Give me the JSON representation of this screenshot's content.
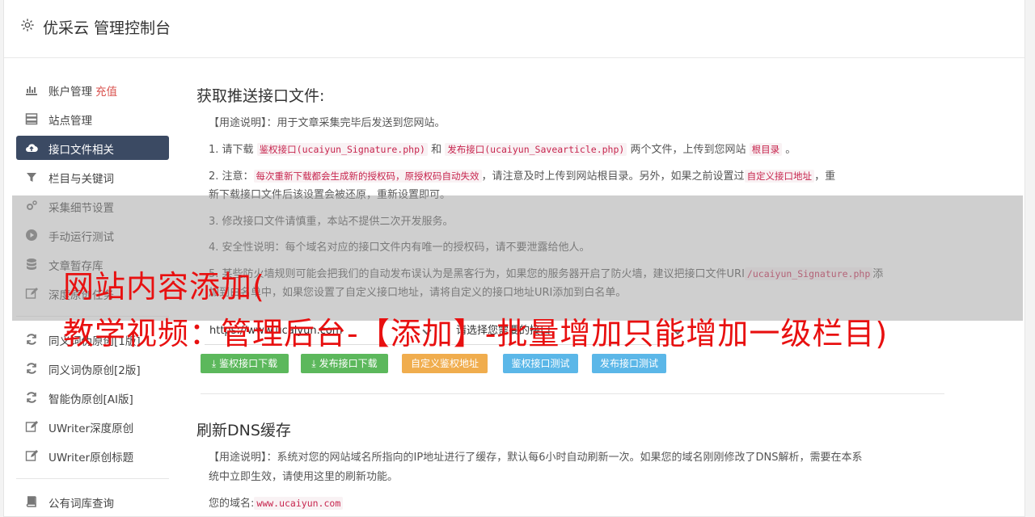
{
  "header": {
    "title": "优采云 管理控制台",
    "icon": "gear-icon"
  },
  "sidebar": {
    "items": [
      {
        "label": "账户管理",
        "extra": "充值",
        "icon": "bar-chart-icon",
        "active": false
      },
      {
        "label": "站点管理",
        "icon": "server-icon",
        "active": false
      },
      {
        "label": "接口文件相关",
        "icon": "cloud-upload-icon",
        "active": true
      },
      {
        "label": "栏目与关键词",
        "icon": "filter-icon",
        "active": false
      },
      {
        "label": "采集细节设置",
        "icon": "cogs-icon",
        "active": false
      },
      {
        "label": "手动运行测试",
        "icon": "play-circle-icon",
        "active": false
      },
      {
        "label": "文章暂存库",
        "icon": "database-icon",
        "active": false
      },
      {
        "label": "深度原创任务",
        "icon": "edit-icon",
        "active": false
      },
      {
        "label": "同义词伪原创[1版]",
        "icon": "refresh-icon",
        "active": false
      },
      {
        "label": "同义词伪原创[2版]",
        "icon": "refresh-icon",
        "active": false
      },
      {
        "label": "智能伪原创[AI版]",
        "icon": "refresh-icon",
        "active": false
      },
      {
        "label": "UWriter深度原创",
        "icon": "edit-icon",
        "active": false
      },
      {
        "label": "UWriter原创标题",
        "icon": "edit-icon",
        "active": false
      },
      {
        "label": "公有词库查询",
        "icon": "book-icon",
        "active": false
      }
    ]
  },
  "section1": {
    "title": "获取推送接口文件:",
    "usage_label": "【用途说明】",
    "usage_text": "：用于文章采集完毕后发送到您网站。",
    "step1": {
      "prefix": "1. 请下载",
      "code1": "鉴权接口(ucaiyun_Signature.php)",
      "mid1": "和",
      "code2": "发布接口(ucaiyun_Savearticle.php)",
      "mid2": "两个文件，上传到您网站",
      "code3": "根目录",
      "suffix": "。"
    },
    "step2": {
      "prefix": "2. 注意：",
      "code1": "每次重新下载都会生成新的授权码，原授权码自动失效",
      "mid1": "，请注意及时上传到网站根目录。另外，如果之前设置过",
      "code2": "自定义接口地址",
      "mid2": "，重",
      "line2": "新下载接口文件后该设置会被还原，重新设置即可。"
    },
    "step3": "3. 修改接口文件请慎重，本站不提供二次开发服务。",
    "step4": "4. 安全性说明：每个域名对应的接口文件内有唯一的授权码，请不要泄露给他人。",
    "step5": {
      "prefix": "5. 某些防火墙规则可能会把我们的自动发布误认为是黑客行为，如果您的服务器开启了防火墙，建议把接口文件URI",
      "code1": "/ucaiyun_Signature.php",
      "suffix": "添",
      "line2": "加到白名单中，如果您设置了自定义接口地址，请将自定义的接口地址URI添加到白名单。"
    },
    "site_select": "https://www.ucaiyun.com",
    "api_select": "请选择您需要的接口",
    "buttons": [
      {
        "label": "鉴权接口下载",
        "color": "green",
        "icon": "download-icon"
      },
      {
        "label": "发布接口下载",
        "color": "green",
        "icon": "download-icon"
      },
      {
        "label": "自定义鉴权地址",
        "color": "orange"
      },
      {
        "label": "鉴权接口测试",
        "color": "blue"
      },
      {
        "label": "发布接口测试",
        "color": "blue"
      }
    ]
  },
  "section2": {
    "title": "刷新DNS缓存",
    "usage_label": "【用途说明】",
    "usage_text": "：系统对您的网站域名所指向的IP地址进行了缓存，默认每6小时自动刷新一次。如果您的域名刚刚修改了DNS解析，需要在本系",
    "usage_line2": "统中立即生效，请使用这里的刷新功能。",
    "domain_label": "您的域名:",
    "domain_value": "www.ucaiyun.com"
  },
  "overlay": {
    "line1": "网站内容添加(",
    "line2": "教学视频：管理后台-【添加】-批量增加只能增加一级栏目)"
  }
}
